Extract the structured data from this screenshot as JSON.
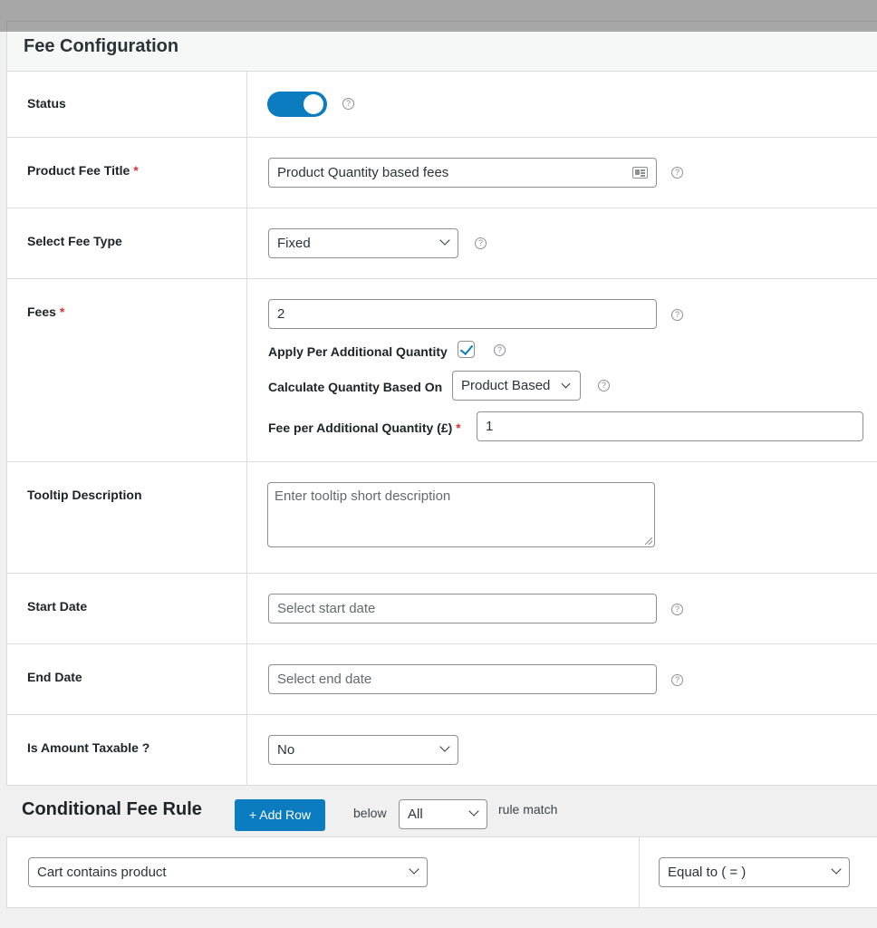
{
  "panel": {
    "title": "Fee Configuration",
    "required_marker": "*",
    "help_glyph": "?",
    "status": {
      "label": "Status",
      "enabled": true
    },
    "fee_title": {
      "label": "Product Fee Title",
      "value": "Product Quantity based fees",
      "icon": "contact-card-icon"
    },
    "fee_type": {
      "label": "Select Fee Type",
      "selected": "Fixed"
    },
    "fees": {
      "label": "Fees",
      "value": "2",
      "apply_per_additional_label": "Apply Per Additional Quantity",
      "apply_per_additional_checked": true,
      "calculate_based_on_label": "Calculate Quantity Based On",
      "calculate_based_on_selected": "Product Based",
      "fee_per_additional_label": "Fee per Additional Quantity (£)",
      "fee_per_additional_value": "1"
    },
    "tooltip": {
      "label": "Tooltip Description",
      "placeholder": "Enter tooltip short description"
    },
    "start_date": {
      "label": "Start Date",
      "placeholder": "Select start date"
    },
    "end_date": {
      "label": "End Date",
      "placeholder": "Select end date"
    },
    "taxable": {
      "label": "Is Amount Taxable ?",
      "selected": "No"
    }
  },
  "conditional": {
    "title": "Conditional Fee Rule",
    "add_row_label": "+ Add Row",
    "below_label": "below",
    "match_selected": "All",
    "rule_match_label": "rule match",
    "condition_selected": "Cart contains product",
    "operator_selected": "Equal to ( = )"
  },
  "colors": {
    "accent": "#0a7cbf",
    "required": "#d63638"
  }
}
